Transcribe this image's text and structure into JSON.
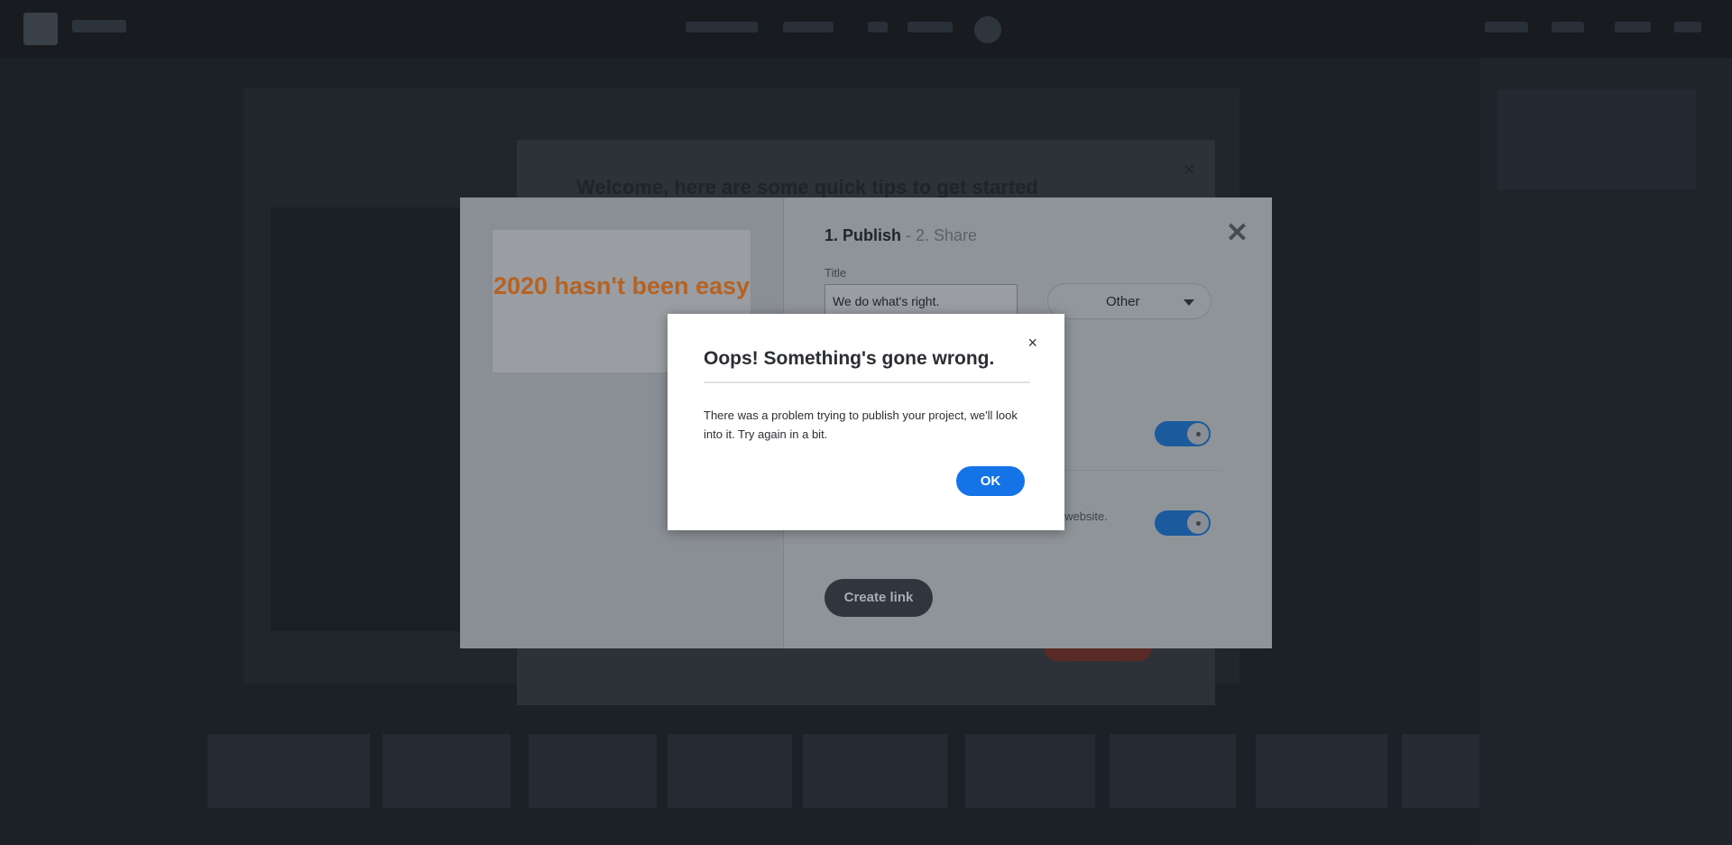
{
  "welcome_modal": {
    "title": "Welcome, here are some quick tips to get started",
    "close_symbol": "×"
  },
  "publish_modal": {
    "step_publish": "1. Publish",
    "step_share": " - 2. Share",
    "close_symbol": "✕",
    "preview_text": "2020 hasn't been easy",
    "title_label": "Title",
    "title_value": "We do what's right.",
    "category_value": "Other",
    "website_text": "c website.",
    "create_link_label": "Create link",
    "toggle_1_on": true,
    "toggle_2_on": true
  },
  "error_dialog": {
    "title": "Oops! Something's gone wrong.",
    "message": "There was a problem trying to publish your project, we'll look into it. Try again in a bit.",
    "ok_label": "OK",
    "close_symbol": "×"
  },
  "colors": {
    "accent_blue": "#1473e6",
    "preview_orange": "#b56222",
    "backdrop": "#1c2127"
  }
}
